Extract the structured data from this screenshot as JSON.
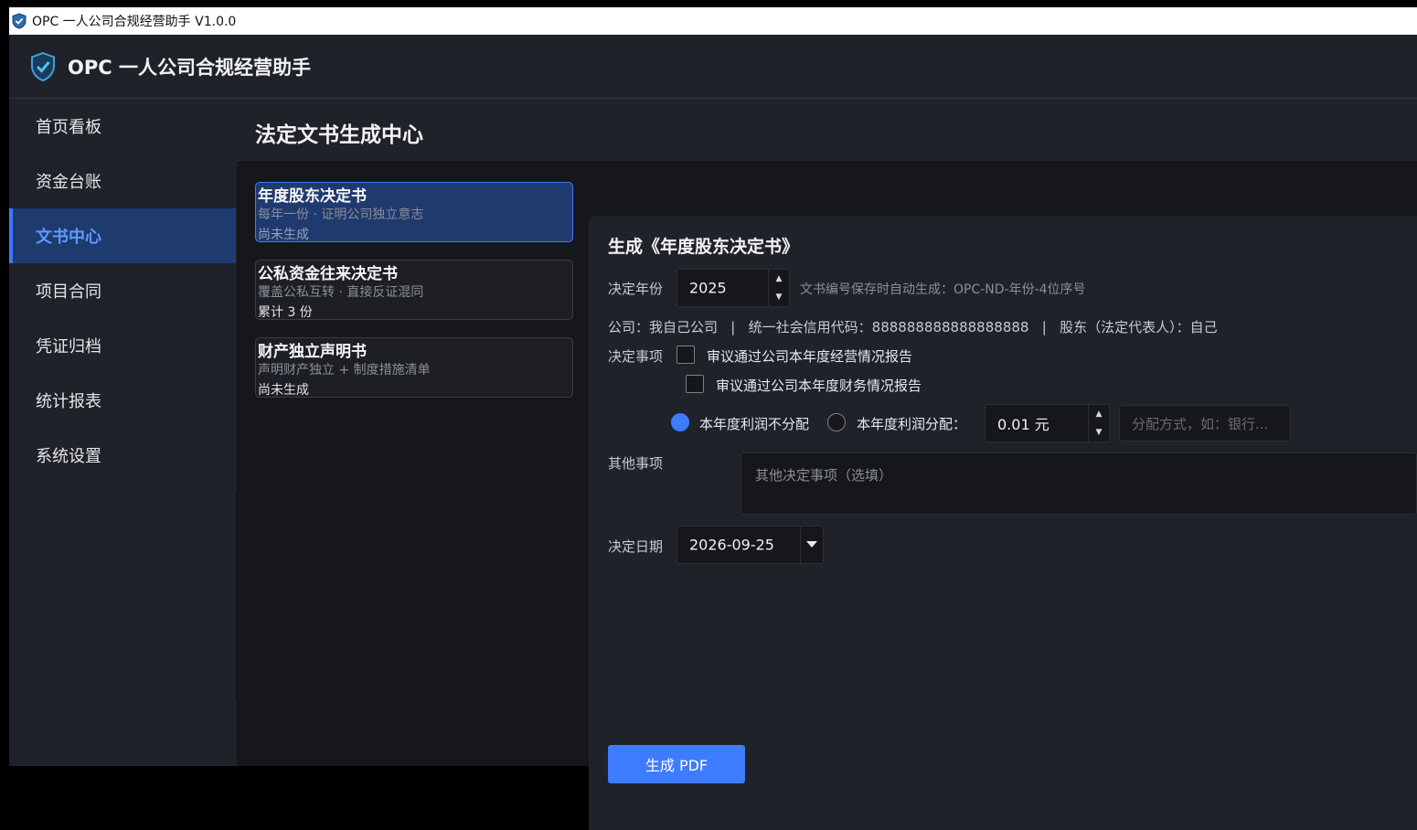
{
  "window": {
    "title": "OPC 一人公司合规经营助手 V1.0.0"
  },
  "header": {
    "app_name": "OPC 一人公司合规经营助手"
  },
  "sidebar": {
    "items": [
      {
        "label": "首页看板"
      },
      {
        "label": "资金台账"
      },
      {
        "label": "文书中心",
        "active": true
      },
      {
        "label": "项目合同"
      },
      {
        "label": "凭证归档"
      },
      {
        "label": "统计报表"
      },
      {
        "label": "系统设置"
      }
    ]
  },
  "page": {
    "title": "法定文书生成中心"
  },
  "doc_list": [
    {
      "title": "年度股东决定书",
      "desc": "每年一份 · 证明公司独立意志",
      "status": "尚未生成",
      "selected": true
    },
    {
      "title": "公私资金往来决定书",
      "desc": "覆盖公私互转 · 直接反证混同",
      "status": "累计 3 份"
    },
    {
      "title": "财产独立声明书",
      "desc": "声明财产独立 + 制度措施清单",
      "status": "尚未生成"
    }
  ],
  "form": {
    "heading": "生成《年度股东决定书》",
    "year_label": "决定年份",
    "year_value": "2025",
    "year_hint": "文书编号保存时自动生成：OPC-ND-年份-4位序号",
    "company_info": "公司：我自己公司   |   统一社会信用代码：888888888888888888   |   股东（法定代表人）：自己",
    "matters_label": "决定事项",
    "matter_1": "审议通过公司本年度经营情况报告",
    "matter_2": "审议通过公司本年度财务情况报告",
    "profit_option_1": "本年度利润不分配",
    "profit_option_2": "本年度利润分配：",
    "profit_selected": "本年度利润不分配",
    "amount_value": "0.01 元",
    "distribution_placeholder": "分配方式，如：银行...",
    "other_label": "其他事项",
    "other_placeholder": "其他决定事项（选填）",
    "date_label": "决定日期",
    "date_value": "2026-09-25",
    "submit_label": "生成 PDF"
  },
  "colors": {
    "accent": "#3d7bff",
    "selected_bg": "#1f3a6e",
    "panel_bg": "#202229",
    "content_bg": "#16171b"
  }
}
